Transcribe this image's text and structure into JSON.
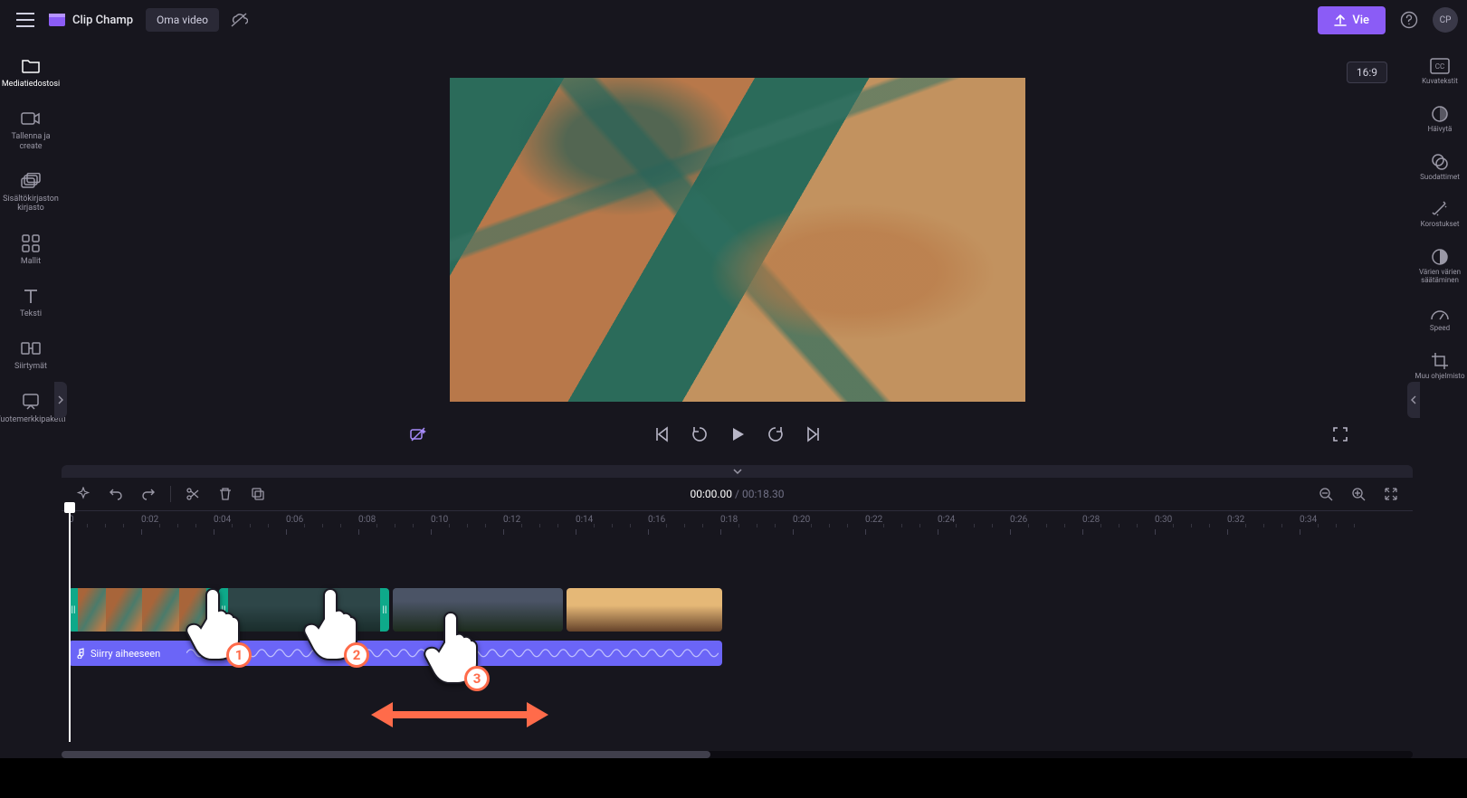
{
  "app": {
    "name": "Clip Champ",
    "project": "Oma video"
  },
  "topbar": {
    "export": "Vie",
    "avatar": "CP"
  },
  "aspect": "16:9",
  "leftnav": [
    {
      "icon": "folder",
      "label": "Mediatiedostosi"
    },
    {
      "icon": "camera",
      "label": "Tallenna ja create"
    },
    {
      "icon": "library",
      "label": "Sisältökirjaston kirjasto"
    },
    {
      "icon": "templates",
      "label": "Mallit"
    },
    {
      "icon": "text",
      "label": "Teksti"
    },
    {
      "icon": "transition",
      "label": "Siirtymät"
    },
    {
      "icon": "brand",
      "label": "Tuotemerkkipaketti"
    }
  ],
  "rightnav": [
    {
      "icon": "cc",
      "label": "Kuvatekstit"
    },
    {
      "icon": "fade",
      "label": "Häivytä"
    },
    {
      "icon": "filters",
      "label": "Suodattimet"
    },
    {
      "icon": "fx",
      "label": "Korostukset"
    },
    {
      "icon": "colors",
      "label": "Värien värien säätäminen"
    },
    {
      "icon": "speed",
      "label": "Speed"
    },
    {
      "icon": "crop",
      "label": "Muu ohjelmisto"
    }
  ],
  "timeline": {
    "current": "00:00.00",
    "total": "00:18.30",
    "ticks": [
      "0",
      "0:02",
      "0:04",
      "0:06",
      "0:08",
      "0:10",
      "0:12",
      "0:14",
      "0:16",
      "0:18",
      "0:20",
      "0:22",
      "0:24",
      "0:26",
      "0:28",
      "0:30",
      "0:32",
      "0:34"
    ]
  },
  "audio_label": "Siirry aiheeseen",
  "annotations": {
    "b1": "1",
    "b2": "2",
    "b3": "3"
  }
}
